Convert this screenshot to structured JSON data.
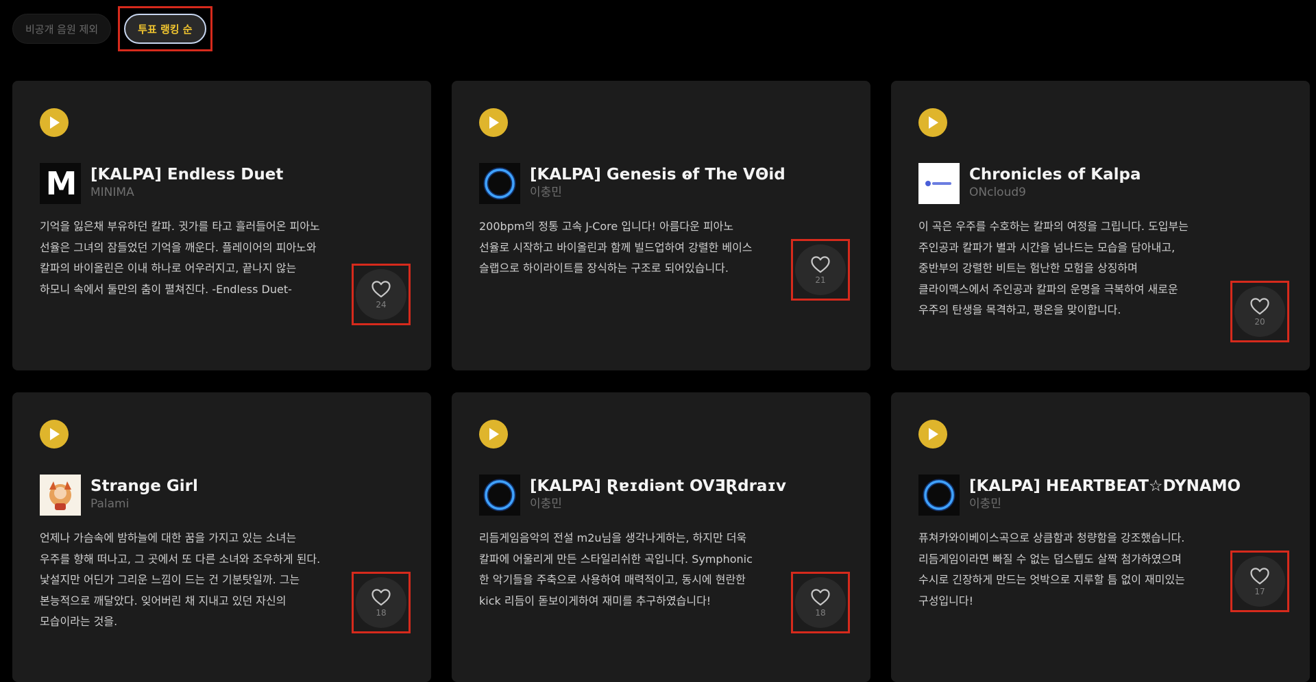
{
  "filters": {
    "exclude_private_label": "비공개 음원 제외",
    "sort_by_votes_label": "투표 랭킹 순"
  },
  "colors": {
    "accent_yellow": "#dfb52c",
    "highlight_red": "#d62a1c",
    "card_bg": "#1c1c1c",
    "page_bg": "#000000"
  },
  "cards": [
    {
      "title": "[KALPA] Endless Duet",
      "artist": "MINIMA",
      "description": "기억을 잃은채 부유하던 칼파. 귓가를 타고 흘러들어온 피아노 선율은 그녀의 잠들었던 기억을 깨운다. 플레이어의 피아노와 칼파의 바이올린은 이내 하나로 어우러지고, 끝나지 않는 하모니 속에서 둘만의 춤이 펼쳐진다. -Endless Duet-",
      "votes": "24",
      "thumb": "minima-logo"
    },
    {
      "title": "[KALPA] Genesis ⱺf The VΘid",
      "artist": "이충민",
      "description": "200bpm의 정통 고속 J-Core 입니다! 아름다운 피아노 선율로 시작하고 바이올린과 함께 빌드업하여 강렬한 베이스 슬랩으로 하이라이트를 장식하는 구조로 되어있습니다.",
      "votes": "21",
      "thumb": "blue-ring"
    },
    {
      "title": "Chronicles of Kalpa",
      "artist": "ONcloud9",
      "description": "이 곡은 우주를 수호하는 칼파의 여정을 그립니다. 도입부는 주인공과 칼파가 별과 시간을 넘나드는 모습을 담아내고, 중반부의 강렬한 비트는 험난한 모험을 상징하며 클라이맥스에서 주인공과 칼파의 운명을 극복하여 새로운 우주의 탄생을 목격하고, 평온을 맞이합니다.",
      "votes": "20",
      "thumb": "oncloud9-logo"
    },
    {
      "title": "Strange Girl",
      "artist": "Palami",
      "description": "언제나 가슴속에 밤하늘에 대한 꿈을 가지고 있는 소녀는 우주를 향해 떠나고, 그 곳에서 또 다른 소녀와 조우하게 된다. 낯설지만 어딘가 그리운 느낌이 드는 건 기분탓일까. 그는 본능적으로 깨달았다. 잊어버린 채 지내고 있던 자신의 모습이라는 것을.",
      "votes": "18",
      "thumb": "character-art"
    },
    {
      "title": "[KALPA] Ɽɐɪdiənt OVƎⱤdraɪv",
      "artist": "이충민",
      "description": "리듬게임음악의 전설 m2u님을 생각나게하는, 하지만 더욱 칼파에 어울리게 만든 스타일리쉬한 곡입니다. Symphonic 한 악기들을 주축으로 사용하여 매력적이고, 동시에 현란한 kick 리듬이 돋보이게하여 재미를 추구하였습니다!",
      "votes": "18",
      "thumb": "blue-ring"
    },
    {
      "title": "[KALPA] HEARTBEAT☆DYNAMO",
      "artist": "이충민",
      "description": "퓨쳐카와이베이스곡으로 상큼함과 청량함을 강조했습니다. 리듬게임이라면 빠질 수 없는 덥스텝도 살짝 첨가하였으며 수시로 긴장하게 만드는 엇박으로 지루할 틈 없이 재미있는 구성입니다!",
      "votes": "17",
      "thumb": "blue-ring"
    }
  ]
}
